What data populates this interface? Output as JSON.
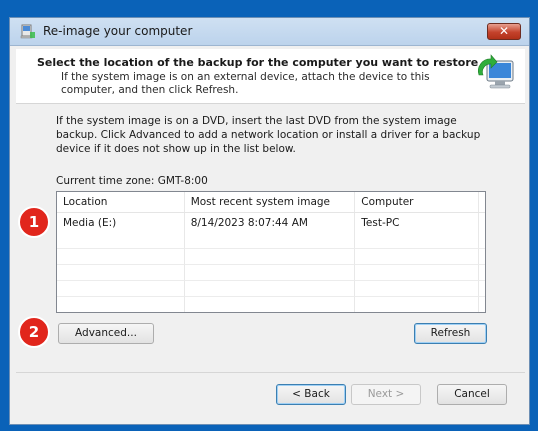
{
  "window": {
    "title": "Re-image your computer",
    "close_glyph": "✕"
  },
  "header": {
    "title": "Select the location of the backup for the computer you want to restore",
    "subtitle": "If the system image is on an external device, attach the device to this computer, and then click Refresh."
  },
  "body": {
    "description": "If the system image is on a DVD, insert the last DVD from the system image backup. Click Advanced to add a network location or install a driver for a backup device if it does not show up in the list below.",
    "timezone": "Current time zone: GMT-8:00"
  },
  "table": {
    "columns": [
      "Location",
      "Most recent system image",
      "Computer"
    ],
    "rows": [
      [
        "Media (E:)",
        "8/14/2023 8:07:44 AM",
        "Test-PC"
      ]
    ]
  },
  "buttons": {
    "advanced": "Advanced...",
    "refresh": "Refresh",
    "back": "< Back",
    "next": "Next >",
    "cancel": "Cancel"
  },
  "annotations": {
    "badge1": "1",
    "badge2": "2"
  },
  "colors": {
    "desktop": "#0a62b8",
    "badge": "#e1261c"
  }
}
